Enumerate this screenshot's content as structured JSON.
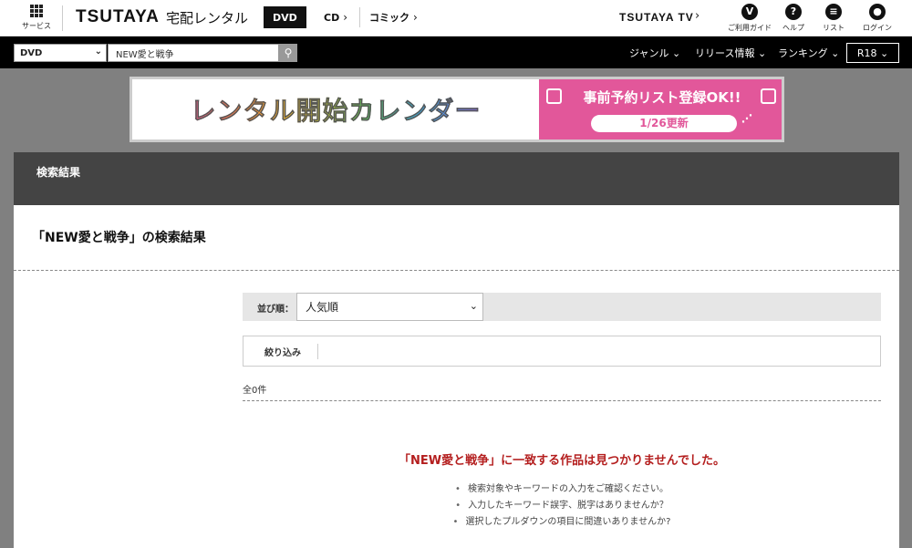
{
  "header": {
    "service_label": "サービス",
    "logo": "TSUTAYA",
    "logo_sub": "宅配レンタル",
    "categories": [
      {
        "label": "DVD",
        "active": true
      },
      {
        "label": "CD",
        "active": false
      },
      {
        "label": "コミック",
        "active": false
      }
    ],
    "tsutaya_tv": "TSUTAYA TV",
    "icons": [
      {
        "name": "guide-icon",
        "glyph": "V",
        "label": "ご利用ガイド"
      },
      {
        "name": "help-icon",
        "glyph": "?",
        "label": "ヘルプ"
      },
      {
        "name": "list-icon",
        "glyph": "≡",
        "label": "リスト"
      },
      {
        "name": "user-icon",
        "glyph": "●",
        "label": "ログイン"
      }
    ]
  },
  "searchbar": {
    "category_value": "DVD",
    "query": "NEW愛と戦争",
    "nav": [
      "ジャンル",
      "リリース情報",
      "ランキング"
    ],
    "r18": "R18"
  },
  "banner": {
    "title": "レンタル開始カレンダー",
    "promo": "事前予約リスト登録OK!!",
    "updated": "1/26更新"
  },
  "main": {
    "header_title": "検索結果",
    "result_title": "「NEW愛と戦争」の検索結果",
    "sort_label": "並び順：",
    "sort_value": "人気順",
    "filter_label": "絞り込み",
    "count": "全0件",
    "no_result": "「NEW愛と戦争」に一致する作品は見つかりませんでした。",
    "tips": [
      "検索対象やキーワードの入力をご確認ください。",
      "入力したキーワード誤字、脱字はありませんか？",
      "選択したプルダウンの項目に間違いありませんか?"
    ]
  }
}
